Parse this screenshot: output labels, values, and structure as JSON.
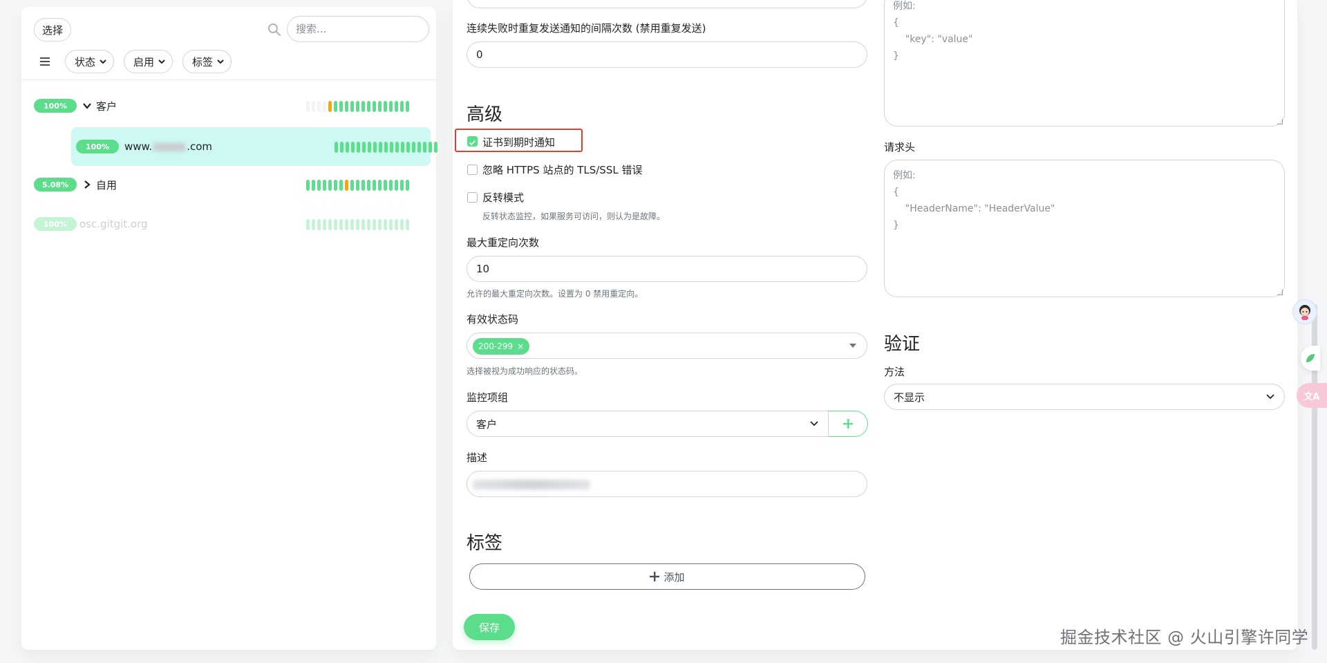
{
  "left": {
    "select_label": "选择",
    "search_placeholder": "搜索...",
    "filters": [
      "状态",
      "启用",
      "标签"
    ],
    "monitors": [
      {
        "badge": "100%",
        "name": "客户",
        "expanded": true
      },
      {
        "badge": "100%",
        "name_prefix": "www.",
        "name_suffix": ".com",
        "child": true
      },
      {
        "badge": "5.08%",
        "name": "自用",
        "expanded": false
      },
      {
        "badge": "100%",
        "name": "osc.gitgit.org",
        "disabled": true
      }
    ]
  },
  "form": {
    "top_input_label": "连续失败时重复发送通知的间隔次数 (禁用重复发送)",
    "top_input_value": "0",
    "advanced_title": "高级",
    "cert_expiry_label": "证书到期时通知",
    "ignore_tls_label": "忽略 HTTPS 站点的 TLS/SSL 错误",
    "invert_label": "反转模式",
    "invert_help": "反转状态监控，如果服务可访问，则认为是故障。",
    "max_redirects_label": "最大重定向次数",
    "max_redirects_value": "10",
    "max_redirects_help": "允许的最大重定向次数。设置为 0 禁用重定向。",
    "status_codes_label": "有效状态码",
    "status_code_chip": "200-299",
    "status_codes_help": "选择被视为成功响应的状态码。",
    "group_label": "监控项组",
    "group_value": "客户",
    "description_label": "描述",
    "tags_title": "标签",
    "add_tag_label": "添加",
    "save_label": "保存"
  },
  "right": {
    "body_example": "例如:\n{\n    \"key\": \"value\"\n}",
    "headers_label": "请求头",
    "headers_example": "例如:\n{\n    \"HeaderName\": \"HeaderValue\"\n}",
    "auth_title": "验证",
    "method_label": "方法",
    "method_value": "不显示"
  },
  "watermark": "掘金技术社区 @ 火山引擎许同学",
  "colors": {
    "accent": "#5cdd8b",
    "warning": "#f8a306",
    "highlight_border": "#e53935",
    "selected_row": "#cdf8f4"
  }
}
